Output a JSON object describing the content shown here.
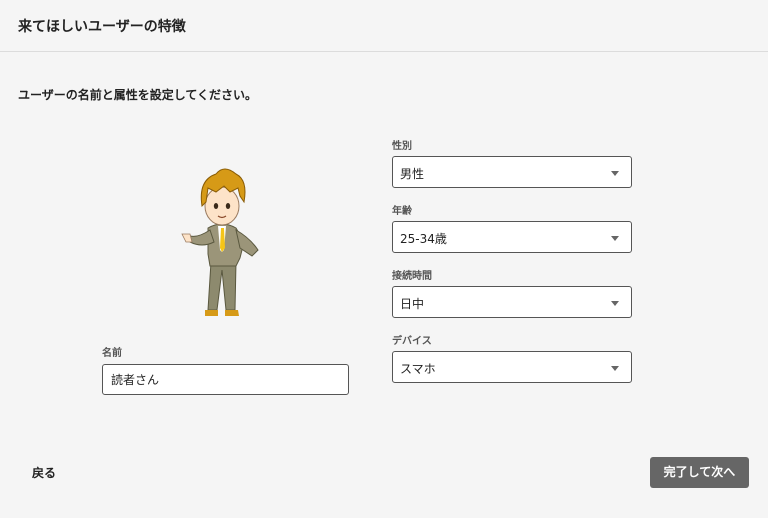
{
  "header": {
    "title": "来てほしいユーザーの特徴"
  },
  "instruction": "ユーザーの名前と属性を設定してください。",
  "name_field": {
    "label": "名前",
    "value": "読者さん"
  },
  "fields": [
    {
      "label": "性別",
      "value": "男性"
    },
    {
      "label": "年齢",
      "value": "25-34歳"
    },
    {
      "label": "接続時間",
      "value": "日中"
    },
    {
      "label": "デバイス",
      "value": "スマホ"
    }
  ],
  "footer": {
    "back_label": "戻る",
    "next_label": "完了して次へ"
  },
  "colors": {
    "background": "#f5f5f5",
    "primary_button": "#666666"
  }
}
